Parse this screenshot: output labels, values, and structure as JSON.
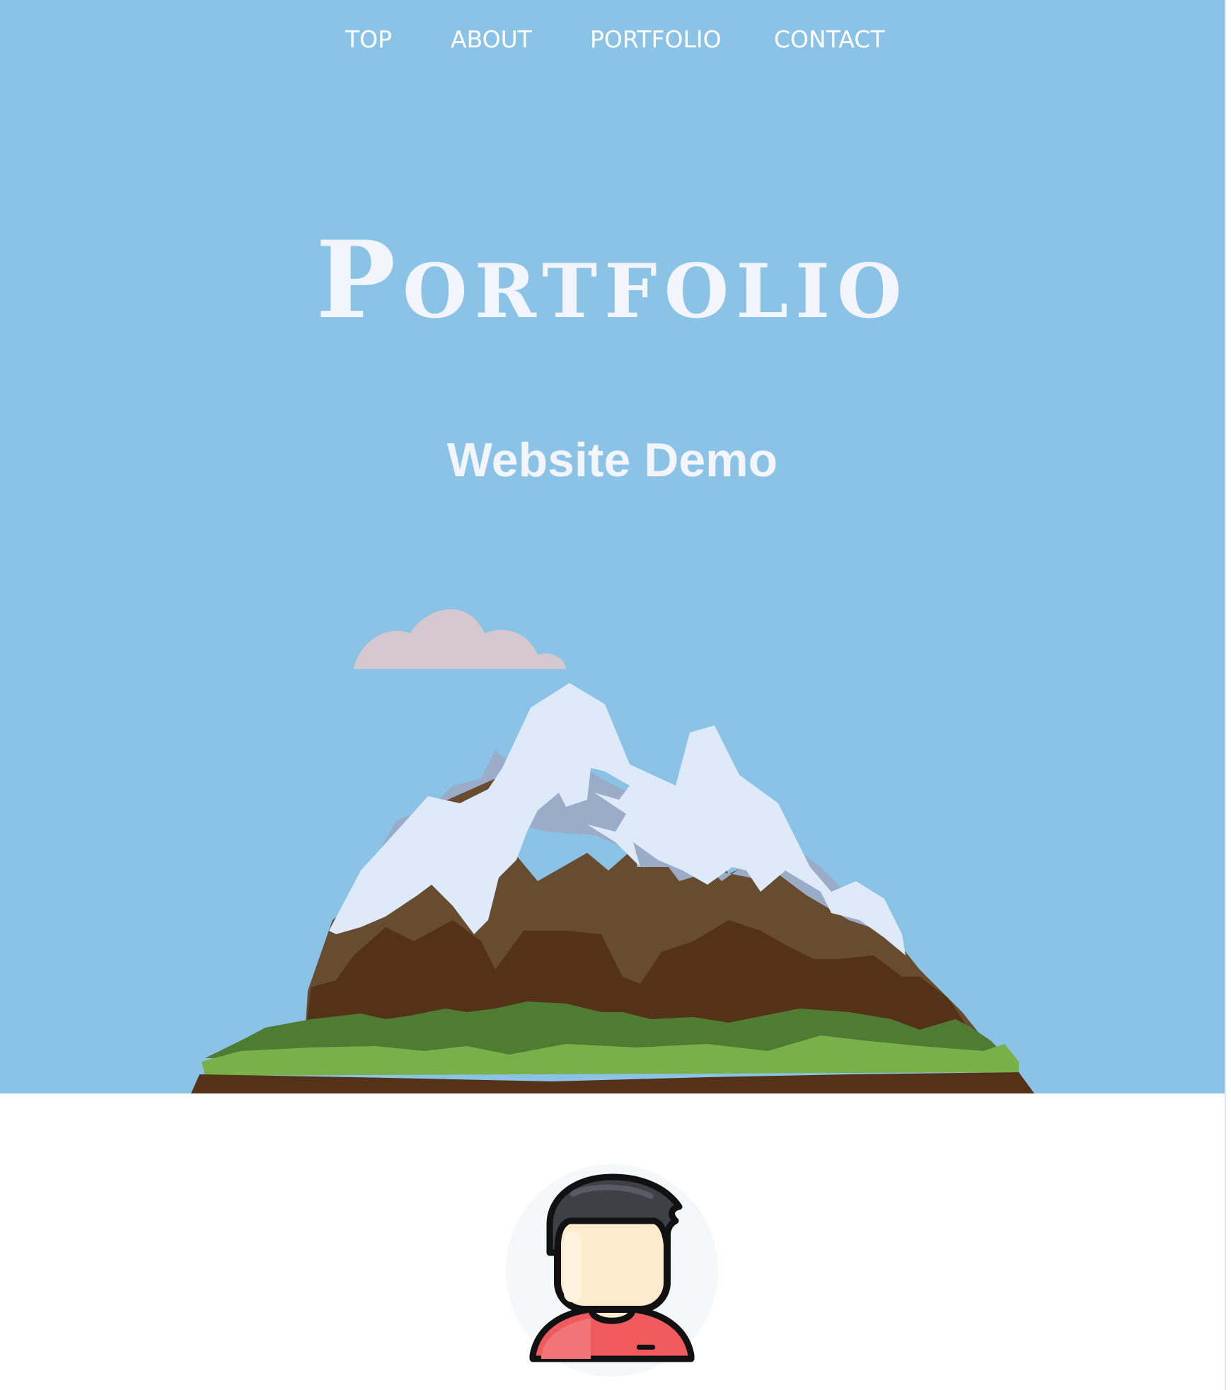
{
  "nav": {
    "items": [
      {
        "label": "TOP"
      },
      {
        "label": "ABOUT"
      },
      {
        "label": "PORTFOLIO"
      },
      {
        "label": "CONTACT"
      }
    ]
  },
  "hero": {
    "title": "Portfolio",
    "subtitle": "Website Demo",
    "background_color": "#8bc3e6",
    "illustration": "mountain-landscape"
  },
  "profile": {
    "avatar_icon": "user-avatar-icon"
  },
  "colors": {
    "text_light": "#f3f5fc",
    "cloud": "#d5c8cf",
    "snow": "#deeaf7",
    "snow_shadow": "#9bacc8",
    "rock": "#674c2f",
    "rock_dark": "#533218",
    "grass": "#4e7c33",
    "grass_light": "#79b04a",
    "shirt": "#ef5a5d",
    "skin": "#fdebce",
    "hair": "#3f3f47"
  }
}
